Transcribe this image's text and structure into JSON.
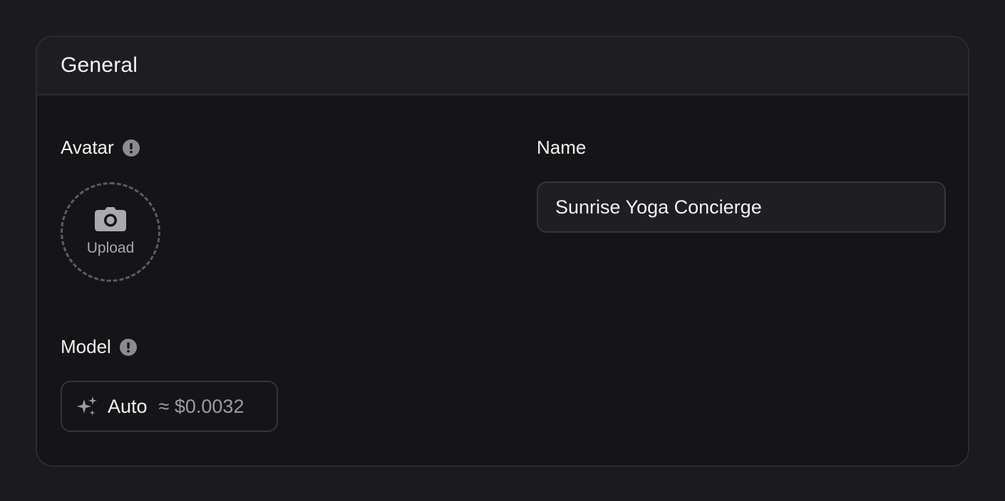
{
  "section": {
    "title": "General"
  },
  "avatar": {
    "label": "Avatar",
    "upload_label": "Upload",
    "info_icon": "info-icon",
    "camera_icon": "camera-icon"
  },
  "name": {
    "label": "Name",
    "value": "Sunrise Yoga Concierge"
  },
  "model": {
    "label": "Model",
    "value": "Auto",
    "cost": "≈ $0.0032",
    "icon": "sparkle-icon",
    "info_icon": "info-icon"
  },
  "colors": {
    "page_background": "#1b1b1d",
    "card_background": "#151517",
    "header_background": "#1e1e21",
    "border": "#2c2c30",
    "text_primary": "#f2f2f3",
    "text_muted": "#9c9ca1"
  }
}
